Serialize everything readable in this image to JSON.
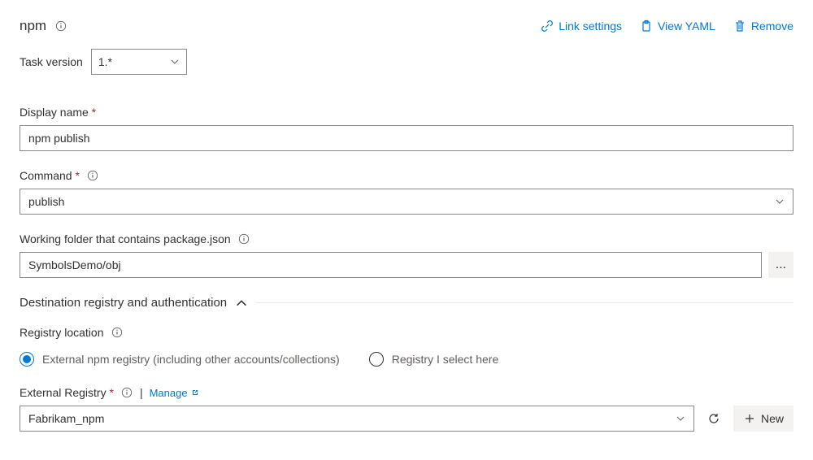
{
  "header": {
    "title": "npm",
    "links": {
      "link_settings": "Link settings",
      "view_yaml": "View YAML",
      "remove": "Remove"
    }
  },
  "task_version": {
    "label": "Task version",
    "value": "1.*"
  },
  "display_name": {
    "label": "Display name",
    "value": "npm publish"
  },
  "command": {
    "label": "Command",
    "value": "publish"
  },
  "working_folder": {
    "label": "Working folder that contains package.json",
    "value": "SymbolsDemo/obj",
    "browse": "..."
  },
  "section": {
    "title": "Destination registry and authentication"
  },
  "registry_location": {
    "label": "Registry location",
    "options": {
      "external": "External npm registry (including other accounts/collections)",
      "select_here": "Registry I select here"
    },
    "selected": "external"
  },
  "external_registry": {
    "label": "External Registry",
    "manage": "Manage",
    "value": "Fabrikam_npm",
    "new_btn": "New"
  }
}
